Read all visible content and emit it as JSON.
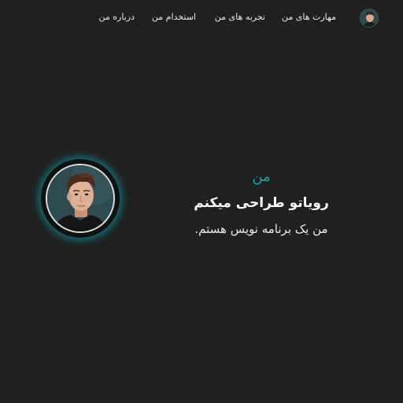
{
  "nav": {
    "avatar_icon": "profile-avatar",
    "links": [
      {
        "label": "مهارت های من"
      },
      {
        "label": "تجربه های من"
      },
      {
        "label": "استخدام من"
      },
      {
        "label": "درباره من"
      }
    ]
  },
  "hero": {
    "eyebrow": "من",
    "title": "رویاتو طراحی میکنم",
    "subtitle": "من یک برنامه نویس هستم."
  },
  "colors": {
    "background": "#202020",
    "accent": "#1aa3a3",
    "glow": "#00bec8"
  }
}
